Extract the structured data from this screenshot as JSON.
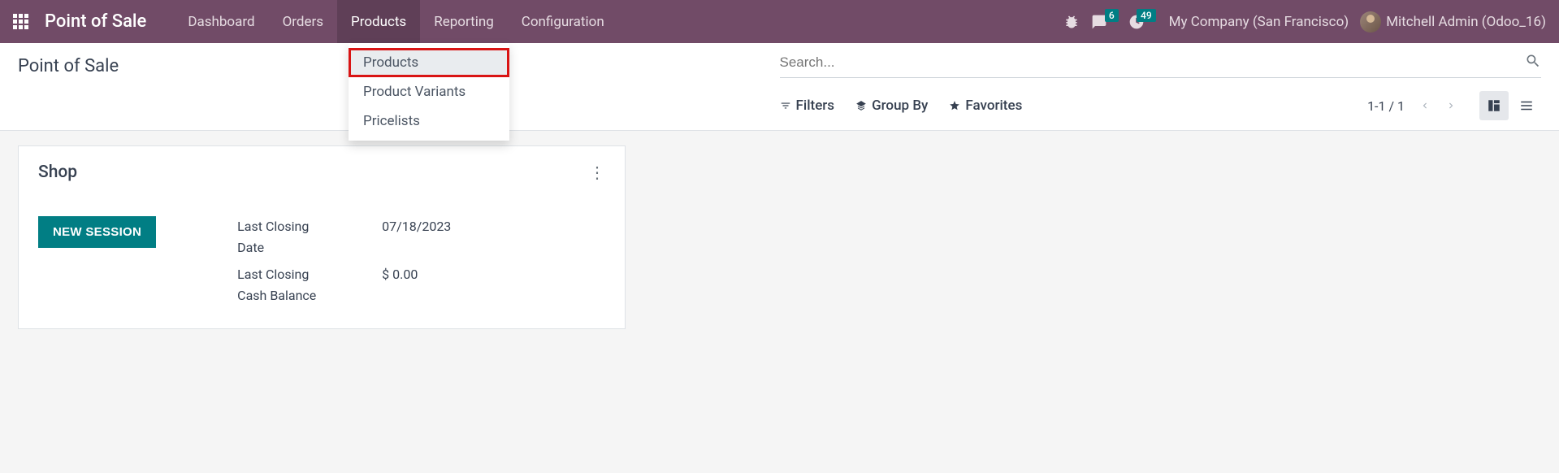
{
  "topbar": {
    "app_title": "Point of Sale",
    "nav": [
      {
        "label": "Dashboard",
        "active": false
      },
      {
        "label": "Orders",
        "active": false
      },
      {
        "label": "Products",
        "active": true
      },
      {
        "label": "Reporting",
        "active": false
      },
      {
        "label": "Configuration",
        "active": false
      }
    ],
    "messages_badge": "6",
    "activities_badge": "49",
    "company": "My Company (San Francisco)",
    "user": "Mitchell Admin (Odoo_16)"
  },
  "dropdown": {
    "items": [
      {
        "label": "Products",
        "hovered": true,
        "highlighted": true
      },
      {
        "label": "Product Variants",
        "hovered": false,
        "highlighted": false
      },
      {
        "label": "Pricelists",
        "hovered": false,
        "highlighted": false
      }
    ]
  },
  "control_panel": {
    "breadcrumb": "Point of Sale",
    "search_placeholder": "Search...",
    "filters_label": "Filters",
    "group_by_label": "Group By",
    "favorites_label": "Favorites",
    "pager": "1-1 / 1"
  },
  "card": {
    "title": "Shop",
    "button_label": "NEW SESSION",
    "stats": [
      {
        "label": "Last Closing Date",
        "value": "07/18/2023"
      },
      {
        "label": "Last Closing Cash Balance",
        "value": "$ 0.00"
      }
    ]
  }
}
